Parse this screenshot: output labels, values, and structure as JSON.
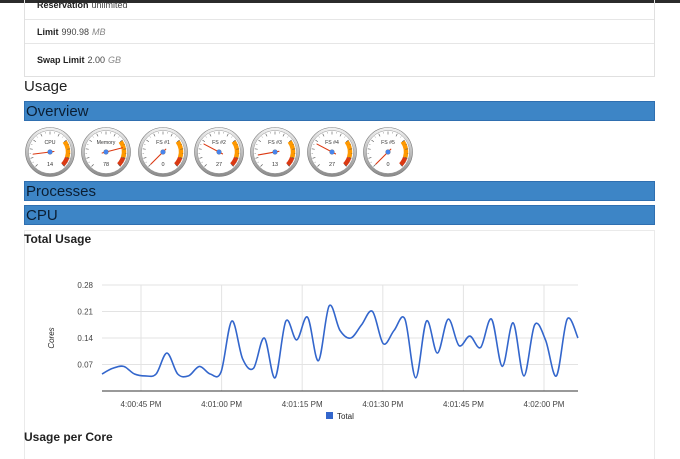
{
  "spec": {
    "reservation": {
      "label": "Reservation",
      "value": "unlimited"
    },
    "limit": {
      "label": "Limit",
      "value": "990.98",
      "unit": "MB"
    },
    "swap": {
      "label": "Swap Limit",
      "value": "2.00",
      "unit": "GB"
    }
  },
  "headings": {
    "usage": "Usage",
    "overview": "Overview",
    "processes": "Processes",
    "cpu": "CPU",
    "total_usage": "Total Usage",
    "usage_per_core": "Usage per Core"
  },
  "gauges": [
    {
      "label": "CPU",
      "value": 14
    },
    {
      "label": "Memory",
      "value": 78
    },
    {
      "label": "FS #1",
      "value": 0
    },
    {
      "label": "FS #2",
      "value": 27
    },
    {
      "label": "FS #3",
      "value": 13
    },
    {
      "label": "FS #4",
      "value": 27
    },
    {
      "label": "FS #5",
      "value": 0
    }
  ],
  "chart_data": {
    "type": "line",
    "ylabel": "Cores",
    "ylim": [
      0,
      0.28
    ],
    "yticks": [
      "0.28",
      "0.21",
      "0.14",
      "0.07"
    ],
    "xticks": [
      "4:00:45 PM",
      "4:01:00 PM",
      "4:01:15 PM",
      "4:01:30 PM",
      "4:01:45 PM",
      "4:02:00 PM"
    ],
    "grid": true,
    "legend": "bottom",
    "series": [
      {
        "name": "Total",
        "color": "#3366cc",
        "values": [
          0.045,
          0.06,
          0.065,
          0.045,
          0.04,
          0.045,
          0.1,
          0.045,
          0.04,
          0.065,
          0.045,
          0.05,
          0.185,
          0.085,
          0.06,
          0.14,
          0.035,
          0.185,
          0.135,
          0.195,
          0.08,
          0.225,
          0.16,
          0.14,
          0.175,
          0.21,
          0.125,
          0.16,
          0.19,
          0.035,
          0.185,
          0.1,
          0.19,
          0.12,
          0.145,
          0.115,
          0.19,
          0.065,
          0.18,
          0.04,
          0.175,
          0.135,
          0.04,
          0.19,
          0.14
        ]
      }
    ]
  }
}
